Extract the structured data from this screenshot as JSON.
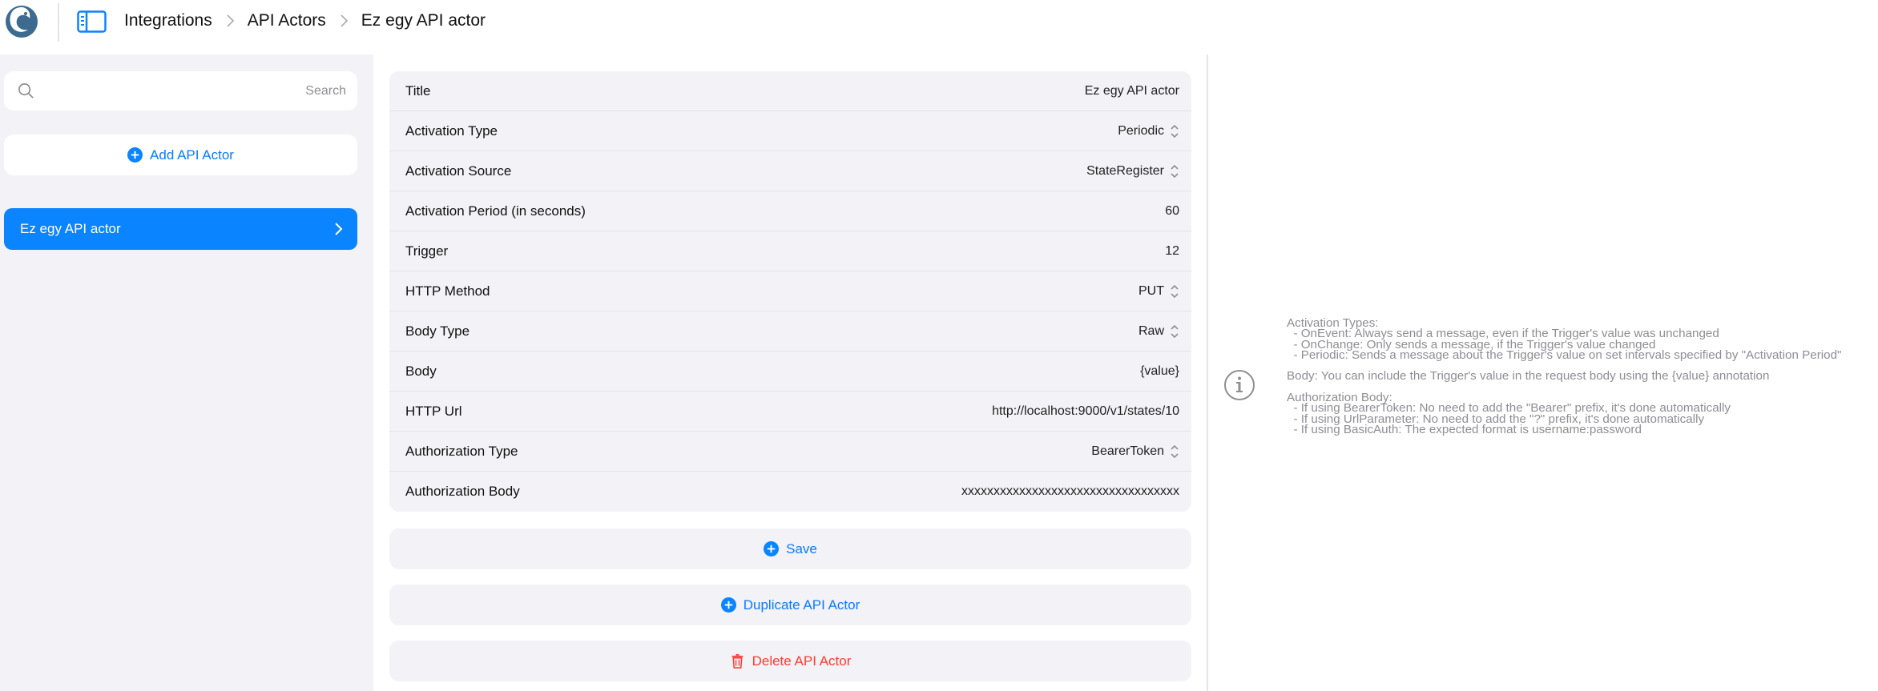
{
  "breadcrumb": {
    "items": [
      "Integrations",
      "API Actors",
      "Ez egy API actor"
    ]
  },
  "sidebar": {
    "search_placeholder": "Search",
    "add_label": "Add API Actor",
    "items": [
      {
        "label": "Ez egy API actor",
        "selected": true
      }
    ]
  },
  "form": {
    "rows": [
      {
        "label": "Title",
        "value": "Ez egy API actor",
        "picker": false
      },
      {
        "label": "Activation Type",
        "value": "Periodic",
        "picker": true
      },
      {
        "label": "Activation Source",
        "value": "StateRegister",
        "picker": true
      },
      {
        "label": "Activation Period (in seconds)",
        "value": "60",
        "picker": false
      },
      {
        "label": "Trigger",
        "value": "12",
        "picker": false
      },
      {
        "label": "HTTP Method",
        "value": "PUT",
        "picker": true
      },
      {
        "label": "Body Type",
        "value": "Raw",
        "picker": true
      },
      {
        "label": "Body",
        "value": "{value}",
        "picker": false
      },
      {
        "label": "HTTP Url",
        "value": "http://localhost:9000/v1/states/10",
        "picker": false
      },
      {
        "label": "Authorization Type",
        "value": "BearerToken",
        "picker": true
      },
      {
        "label": "Authorization Body",
        "value": "xxxxxxxxxxxxxxxxxxxxxxxxxxxxxxxxxx",
        "picker": false
      }
    ]
  },
  "actions": {
    "save": "Save",
    "duplicate": "Duplicate API Actor",
    "delete": "Delete API Actor"
  },
  "info": {
    "text": "Activation Types:\n  - OnEvent: Always send a message, even if the Trigger's value was unchanged\n  - OnChange: Only sends a message, if the Trigger's value changed\n  - Periodic: Sends a message about the Trigger's value on set intervals specified by \"Activation Period\"\n\nBody: You can include the Trigger's value in the request body using the {value} annotation\n\nAuthorization Body:\n  - If using BearerToken: No need to add the \"Bearer\" prefix, it's done automatically\n  - If using UrlParameter: No need to add the \"?\" prefix, it's done automatically\n  - If using BasicAuth: The expected format is username:password"
  },
  "colors": {
    "accent": "#0a84ff",
    "link": "#0a7aff",
    "danger": "#ff3b30",
    "panel": "#f2f2f7"
  }
}
